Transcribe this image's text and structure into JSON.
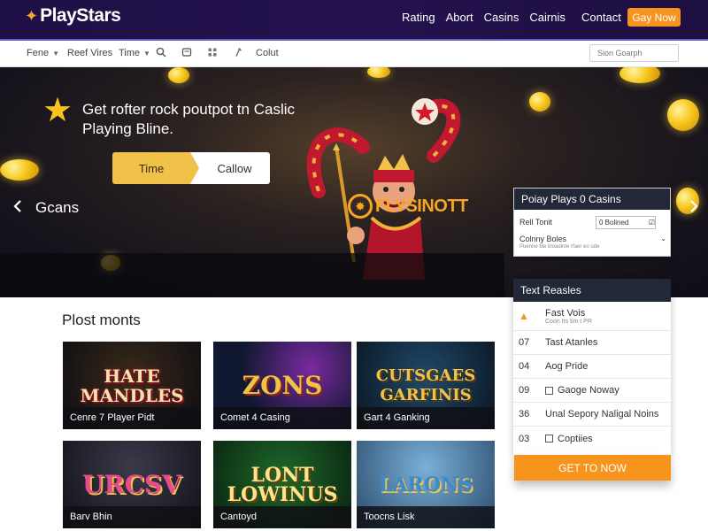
{
  "header": {
    "logo": "PlayStars",
    "logo_icon": "star-icon",
    "nav": [
      "Rating",
      "Abort",
      "Casins",
      "Cairnis"
    ],
    "contact": "Contact",
    "cta": "Gay Now"
  },
  "filterbar": {
    "items": [
      "Fene",
      "Reef Vires",
      "Time"
    ],
    "icons": [
      "search-icon",
      "tag-icon",
      "grid-icon",
      "pin-icon"
    ],
    "extra": "Colut",
    "search_placeholder": "Sion Goarph"
  },
  "hero": {
    "title": "Get rofter rock poutpot tn Caslic Playing Bline.",
    "toggle_left": "Time",
    "toggle_right": "Callow",
    "band_label": "Gcans",
    "band_logo": "FLYSINOTT"
  },
  "widget": {
    "title": "Poiay Plays 0 Casins",
    "row1_label": "Rell Tonit",
    "row1_value": "0 Bolined",
    "row2_label": "Colnny Boles",
    "row2_sub": "Puenne bie bloadinte rfaer eo ude"
  },
  "listpanel": {
    "title": "Text Reasles",
    "rows": [
      {
        "num": "",
        "label": "Fast Vois",
        "sub": "Coon Its tim t PR"
      },
      {
        "num": "07",
        "label": "Tast Atanles"
      },
      {
        "num": "04",
        "label": "Aog Pride"
      },
      {
        "num": "09",
        "label": "Gaoge Noway"
      },
      {
        "num": "36",
        "label": "Unal Sepory Naligal Noins"
      },
      {
        "num": "03",
        "label": "Coptiies"
      }
    ],
    "cta": "GET TO NOW"
  },
  "section": {
    "title": "Plost monts"
  },
  "games": [
    {
      "art": "HATE MANDLES",
      "label": "Cenre 7 Player Pidt"
    },
    {
      "art": "ZONS",
      "label": "Comet 4 Casing"
    },
    {
      "art": "CUTSGAES GARFINIS",
      "label": "Gart 4 Ganking"
    },
    {
      "art": "URCSV",
      "label": "Barv Bhin"
    },
    {
      "art": "LONT LOWINUS",
      "label": "Cantoyd"
    },
    {
      "art": "LARONS",
      "label": "Toocns Lisk"
    }
  ],
  "colors": {
    "header_bg": "#1e1045",
    "accent": "#f7941d",
    "panel_head": "#222838",
    "gold": "#f0c24a"
  }
}
